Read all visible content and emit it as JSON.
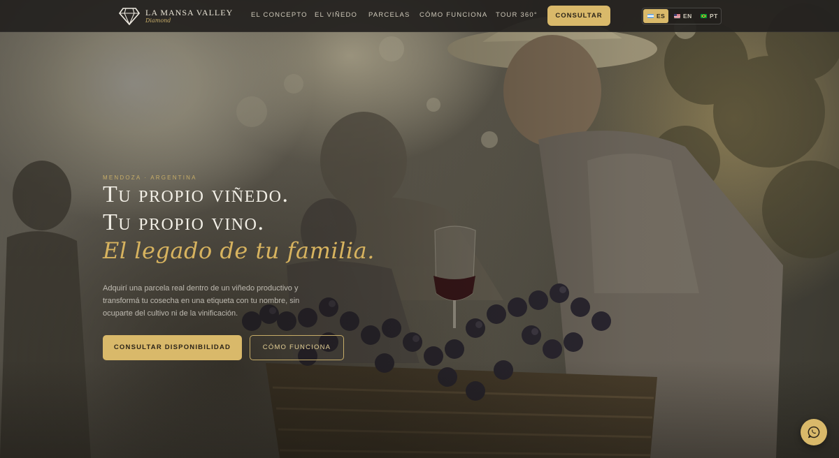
{
  "brand": {
    "name": "LA MANSA VALLEY",
    "subtitle": "Diamond",
    "logo_icon": "diamond-vine-icon"
  },
  "nav": {
    "links": [
      "EL CONCEPTO",
      "EL VIÑEDO",
      "PARCELAS",
      "CÓMO FUNCIONA",
      "TOUR 360°"
    ],
    "cta_label": "CONSULTAR"
  },
  "languages": [
    {
      "code": "ES",
      "flag": "argentina-flag-icon",
      "active": true
    },
    {
      "code": "EN",
      "flag": "usa-flag-icon",
      "active": false
    },
    {
      "code": "PT",
      "flag": "brazil-flag-icon",
      "active": false
    }
  ],
  "hero": {
    "eyebrow": "MENDOZA · ARGENTINA",
    "headline_line1": "Tu propio viñedo.",
    "headline_line2": "Tu propio vino.",
    "headline_script": "El legado de tu familia.",
    "description": "Adquirí una parcela real dentro de un viñedo productivo y transformá tu cosecha en una etiqueta con tu nombre, sin ocuparte del cultivo ni de la vinificación.",
    "primary_button": "CONSULTAR DISPONIBILIDAD",
    "secondary_button": "CÓMO FUNCIONA"
  },
  "floating": {
    "whatsapp_icon": "whatsapp-icon"
  },
  "colors": {
    "accent_gold": "#d9b96a",
    "navbar_bg": "#23211e",
    "script_gold": "#d7b35f"
  }
}
